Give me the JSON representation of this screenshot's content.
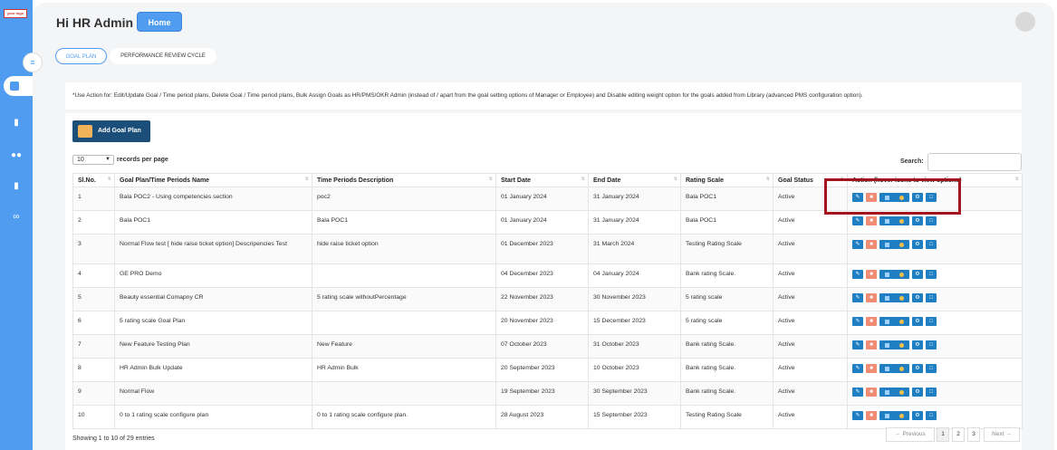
{
  "sidebar": {
    "logo_text": "your logo",
    "icons": [
      "collapse-icon",
      "dashboard-icon",
      "book-icon",
      "users-icon",
      "book-icon",
      "link-icon"
    ]
  },
  "header": {
    "greeting": "Hi HR Admin",
    "home_label": "Home"
  },
  "tabs": [
    {
      "label": "GOAL PLAN",
      "active": true
    },
    {
      "label": "PERFORMANCE REVIEW CYCLE",
      "active": false
    }
  ],
  "note": "*Use Action for: Edit/Update Goal / Time period plans, Delete Goal / Time period plans, Bulk Assign Goals as HR/PMS/OKR Admin (instead of / apart from the goal setting options of Manager or Employee) and Disable editing weight option for the goals added from Library (advanced PMS configuration option).",
  "add_button_label": "Add Goal Plan",
  "length_select": {
    "value": "10",
    "label": "records per page"
  },
  "search_label": "Search:",
  "table": {
    "columns": [
      "Sl.No.",
      "Goal Plan/Time Periods Name",
      "Time Periods Description",
      "Start Date",
      "End Date",
      "Rating Scale",
      "Goal Status",
      "Action (hover icons to view options)"
    ],
    "rows": [
      {
        "sl": "1",
        "name": "Bala POC2 - Using competencies section",
        "desc": "poc2",
        "start": "01 January 2024",
        "end": "31 January 2024",
        "scale": "Bala POC1",
        "status": "Active"
      },
      {
        "sl": "2",
        "name": "Bala POC1",
        "desc": "Bala POC1",
        "start": "01 January 2024",
        "end": "31 January 2024",
        "scale": "Bala POC1",
        "status": "Active"
      },
      {
        "sl": "3",
        "name": "Normal Flow test [ hide raise ticket option] Descripencies Test",
        "desc": "hide raise ticket option",
        "start": "01 December 2023",
        "end": "31 March 2024",
        "scale": "Testing Rating Scale",
        "status": "Active"
      },
      {
        "sl": "4",
        "name": "GE PRO Demo",
        "desc": "",
        "start": "04 December 2023",
        "end": "04 January 2024",
        "scale": "Bank rating Scale.",
        "status": "Active"
      },
      {
        "sl": "5",
        "name": "Beauty essential Comapny CR",
        "desc": "5 rating scale withoutPercentage",
        "start": "22 November 2023",
        "end": "30 November 2023",
        "scale": "5 rating scale",
        "status": "Active"
      },
      {
        "sl": "6",
        "name": "5 rating scale Goal Plan",
        "desc": "",
        "start": "20 November 2023",
        "end": "15 December 2023",
        "scale": "5 rating scale",
        "status": "Active"
      },
      {
        "sl": "7",
        "name": "New Feature Testing Plan",
        "desc": "New Feature",
        "start": "07 October 2023",
        "end": "31 October 2023",
        "scale": "Bank rating Scale.",
        "status": "Active"
      },
      {
        "sl": "8",
        "name": "HR Admin Bulk Update",
        "desc": "HR Admin Bulk",
        "start": "20 September 2023",
        "end": "10 October 2023",
        "scale": "Bank rating Scale.",
        "status": "Active"
      },
      {
        "sl": "9",
        "name": "Normal Flow",
        "desc": "",
        "start": "19 September 2023",
        "end": "30 September 2023",
        "scale": "Bank rating Scale.",
        "status": "Active"
      },
      {
        "sl": "10",
        "name": "0 to 1 rating scale configure plan",
        "desc": "0 to 1 rating scale configure plan.",
        "start": "28 August 2023",
        "end": "15 September 2023",
        "scale": "Testing Rating Scale",
        "status": "Active"
      }
    ]
  },
  "footer_info": "Showing 1 to 10 of 29 entries",
  "pagination": {
    "previous": "← Previous",
    "pages": [
      "1",
      "2",
      "3"
    ],
    "next": "Next →"
  },
  "colors": {
    "sidebar": "#4f9cf0",
    "primary_button": "#1b4f7a",
    "highlight_box": "#a3141e"
  }
}
